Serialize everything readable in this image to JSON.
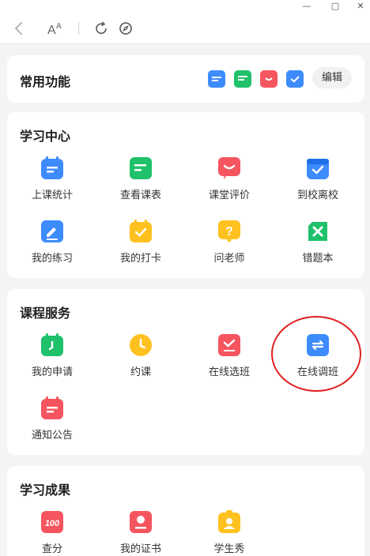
{
  "colors": {
    "blue": "#3d8bfd",
    "green": "#1fc16b",
    "red": "#f5555f",
    "yellow": "#ffc11f",
    "annotation": "#e02020"
  },
  "window": {
    "controls": [
      "minimize",
      "maximize",
      "close"
    ]
  },
  "toolbar": {
    "buttons": [
      "back-icon",
      "font-size-icon",
      "refresh-icon",
      "compass-icon"
    ]
  },
  "common": {
    "title": "常用功能",
    "edit_label": "编辑",
    "icons": [
      "calendar-blue-icon",
      "schedule-green-icon",
      "chat-red-icon",
      "checkin-blue-icon"
    ]
  },
  "study_center": {
    "title": "学习中心",
    "items": [
      {
        "label": "上课统计",
        "icon": "calendar-stats-icon"
      },
      {
        "label": "查看课表",
        "icon": "timetable-icon"
      },
      {
        "label": "课堂评价",
        "icon": "smile-chat-icon"
      },
      {
        "label": "到校离校",
        "icon": "check-box-icon"
      },
      {
        "label": "我的练习",
        "icon": "pencil-exercise-icon"
      },
      {
        "label": "我的打卡",
        "icon": "clock-in-icon"
      },
      {
        "label": "问老师",
        "icon": "question-icon"
      },
      {
        "label": "错题本",
        "icon": "wrong-book-icon"
      }
    ]
  },
  "course_services": {
    "title": "课程服务",
    "items": [
      {
        "label": "我的申请",
        "icon": "application-icon"
      },
      {
        "label": "约课",
        "icon": "appointment-clock-icon"
      },
      {
        "label": "在线选班",
        "icon": "select-class-icon"
      },
      {
        "label": "在线调班",
        "icon": "switch-class-icon"
      },
      {
        "label": "通知公告",
        "icon": "notice-icon"
      }
    ]
  },
  "achievements": {
    "title": "学习成果",
    "items": [
      {
        "label": "查分",
        "icon": "score-100-icon"
      },
      {
        "label": "我的证书",
        "icon": "certificate-icon"
      },
      {
        "label": "学生秀",
        "icon": "student-show-icon"
      }
    ]
  }
}
